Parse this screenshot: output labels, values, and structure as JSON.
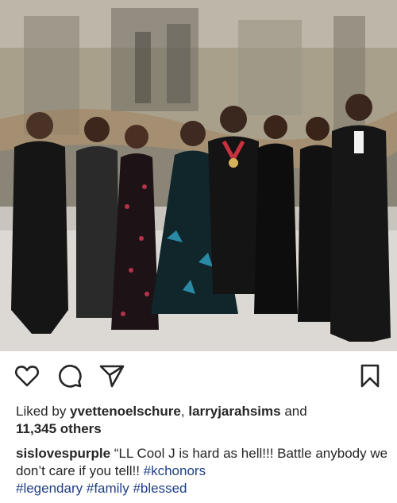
{
  "post": {
    "image_alt": "Group photo of eight people in formal attire in front of a painted mural",
    "ribbon_color": "#c9313f"
  },
  "actions": {
    "like_icon": "heart-icon",
    "comment_icon": "comment-icon",
    "share_icon": "send-icon",
    "save_icon": "bookmark-icon"
  },
  "likes": {
    "prefix": "Liked by ",
    "user1": "yvettenoelschure",
    "separator": ", ",
    "user2": "larryjarahsims",
    "and_text": " and",
    "count": "11,345 others"
  },
  "caption": {
    "username": "sislovespurple",
    "text": " “LL Cool J is hard as hell!!! Battle anybody we don’t care if you tell!! ",
    "hashtags": [
      "#kchonors",
      "#legendary",
      "#family",
      "#blessed"
    ]
  }
}
